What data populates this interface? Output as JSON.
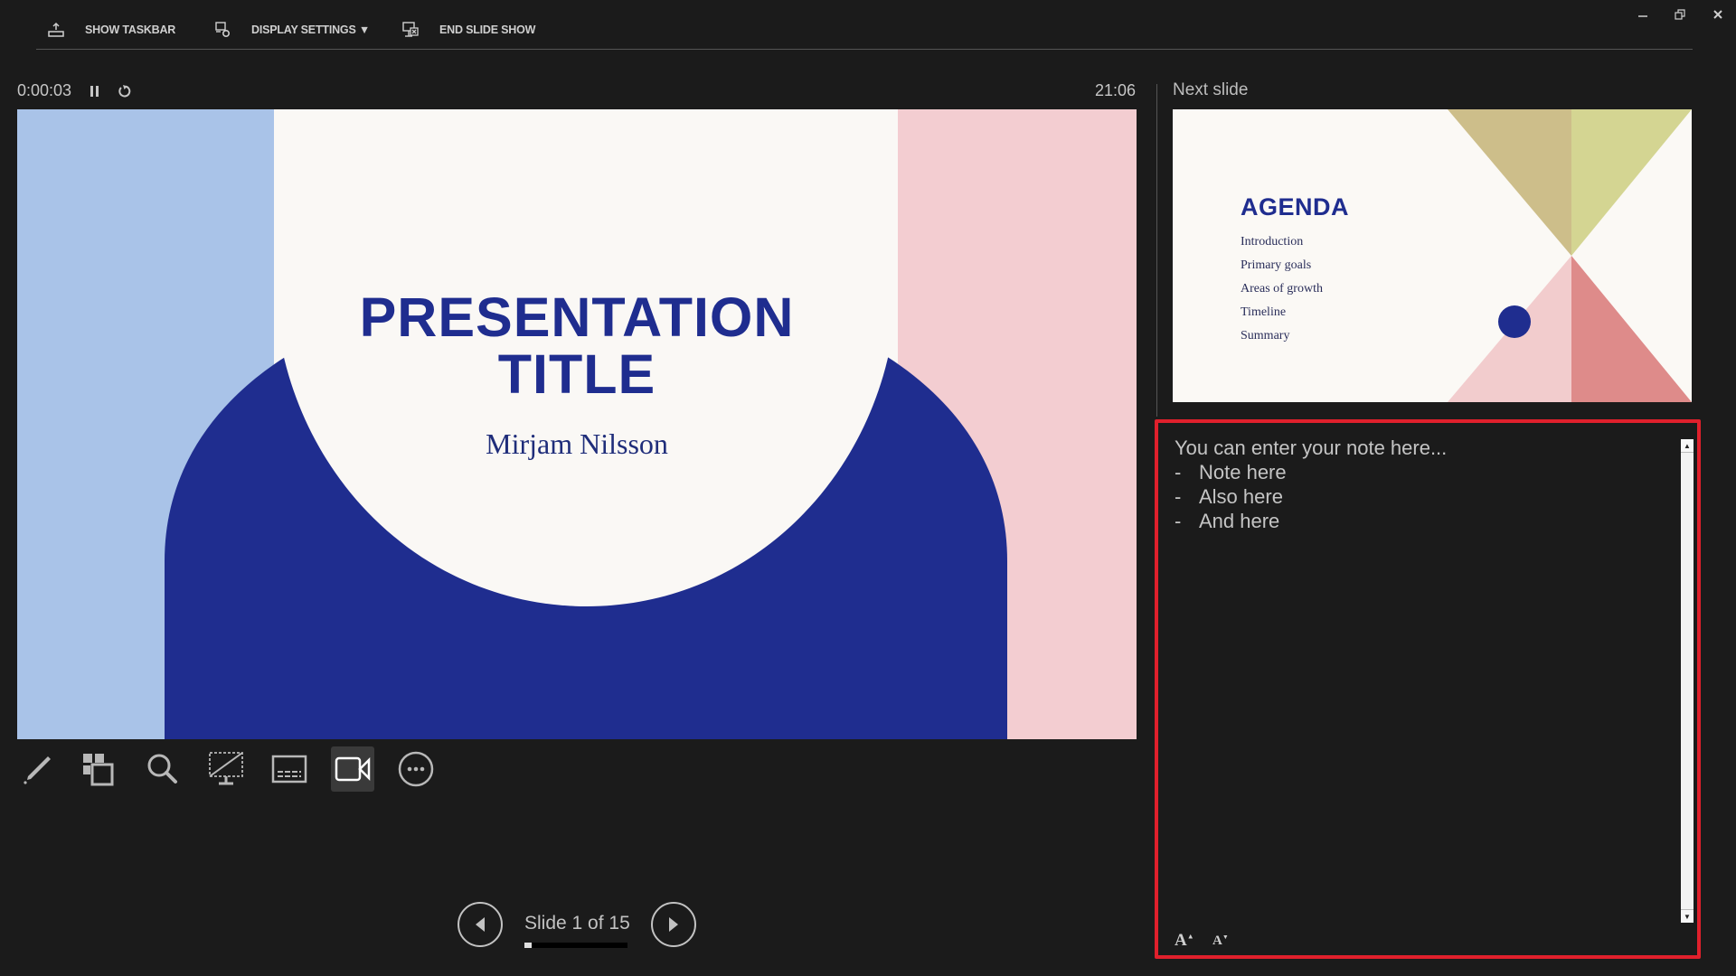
{
  "topbar": {
    "show_taskbar": "SHOW TASKBAR",
    "display_settings": "DISPLAY SETTINGS ▼",
    "end_slide_show": "END SLIDE SHOW"
  },
  "window_controls": {
    "minimize": "–",
    "restore": "⧉",
    "close": "✕"
  },
  "timer": {
    "elapsed": "0:00:03",
    "pause_icon": "pause-icon",
    "reset_icon": "restart-icon"
  },
  "clock": "21:06",
  "current_slide": {
    "title_line1": "PRESENTATION",
    "title_line2": "TITLE",
    "subtitle": "Mirjam Nilsson",
    "colors": {
      "left_strip": "#a9c3e8",
      "right_strip": "#f3cdd1",
      "arch": "#1f2d8f",
      "background": "#faf8f5"
    }
  },
  "next_slide": {
    "label": "Next slide",
    "title": "AGENDA",
    "items": [
      "Introduction",
      "Primary goals",
      "Areas of growth",
      "Timeline",
      "Summary"
    ],
    "colors": {
      "tri_top_left": "#cdbe8a",
      "tri_top_right": "#d4d592",
      "tri_bottom_left": "#f2cccd",
      "tri_bottom_right": "#de8b8a",
      "dot": "#1f2d8f"
    }
  },
  "notes": {
    "intro": "You can enter your note here...",
    "items": [
      "Note here",
      "Also here",
      "And here"
    ],
    "bullet": "-",
    "increase_font": "A",
    "decrease_font": "A",
    "highlight_color": "#e0202c"
  },
  "toolbar": {
    "tools": [
      "pen-tool",
      "see-all-slides",
      "zoom-into-slide",
      "black-or-unblack-slideshow",
      "toggle-subtitles",
      "camera",
      "more-options"
    ],
    "active_tool": "camera"
  },
  "navigation": {
    "slide_counter": "Slide 1 of 15",
    "current": 1,
    "total": 15,
    "progress_fraction": 0.067
  }
}
